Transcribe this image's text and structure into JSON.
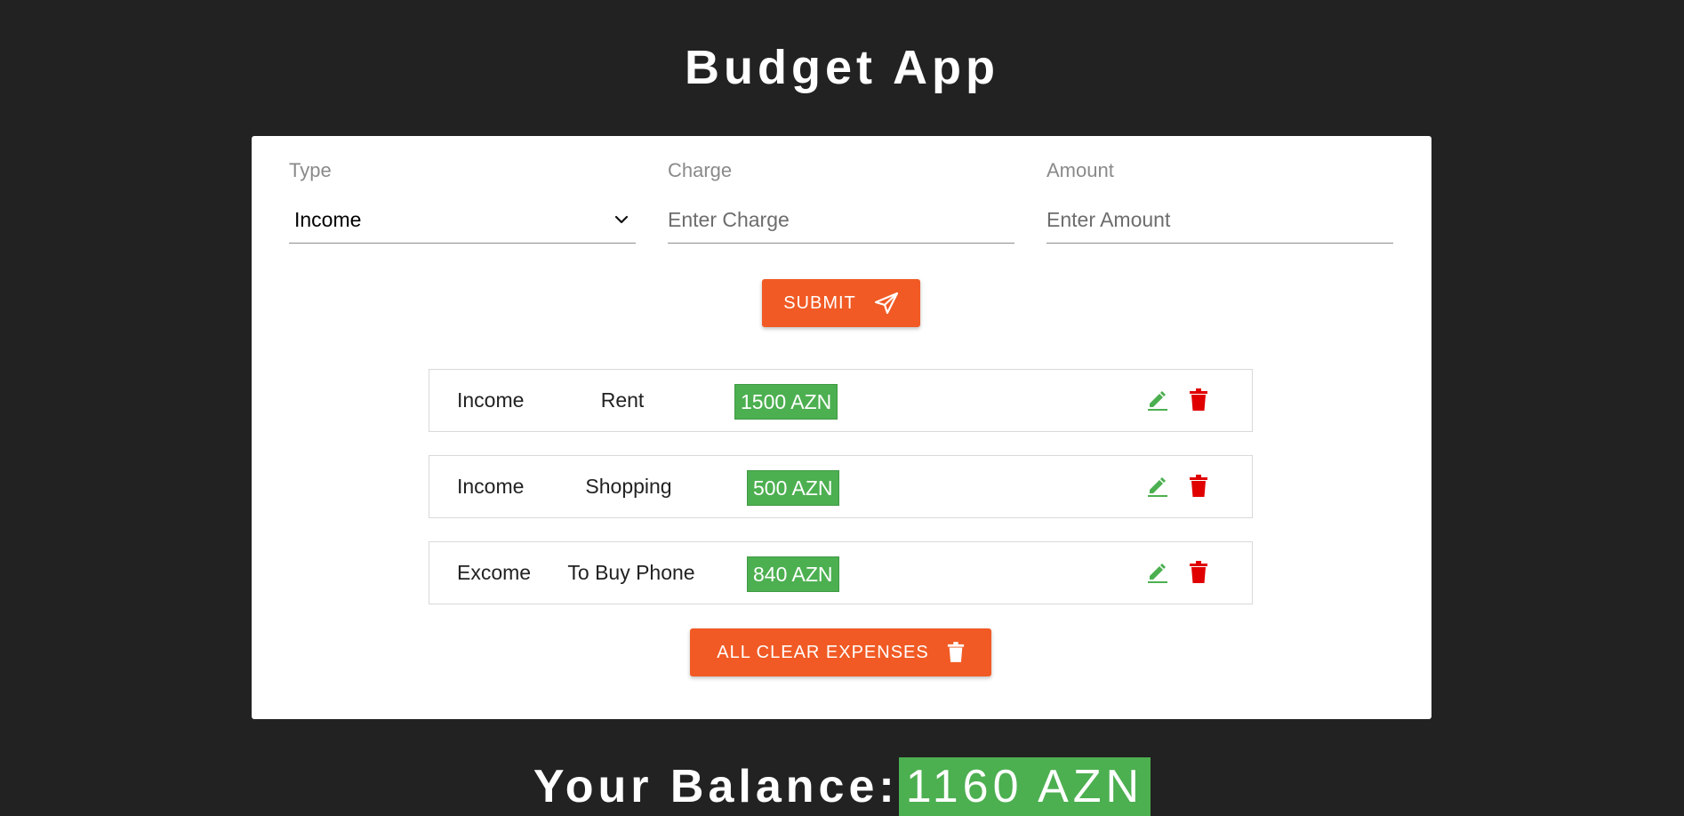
{
  "app": {
    "title": "Budget App"
  },
  "form": {
    "type_label": "Type",
    "type_value": "Income",
    "charge_label": "Charge",
    "charge_placeholder": "Enter Charge",
    "charge_value": "",
    "amount_label": "Amount",
    "amount_placeholder": "Enter Amount",
    "amount_value": "",
    "submit_label": "SUBMIT",
    "submit_icon": "paper-plane-icon"
  },
  "expenses": [
    {
      "type": "Income",
      "charge": "Rent",
      "amount": "1500 AZN",
      "edit_icon": "pencil-icon",
      "delete_icon": "trash-icon"
    },
    {
      "type": "Income",
      "charge": "Shopping",
      "amount": "500 AZN",
      "edit_icon": "pencil-icon",
      "delete_icon": "trash-icon"
    },
    {
      "type": "Excome",
      "charge": "To Buy Phone",
      "amount": "840 AZN",
      "edit_icon": "pencil-icon",
      "delete_icon": "trash-icon"
    }
  ],
  "actions": {
    "clear_label": "ALL CLEAR EXPENSES",
    "clear_icon": "trash-icon"
  },
  "balance": {
    "label": "Your Balance:",
    "value": "1160 AZN"
  },
  "colors": {
    "background": "#222222",
    "card": "#ffffff",
    "accent": "#f15a24",
    "amount_badge": "#4caf50",
    "edit_icon": "#4caf50",
    "delete_icon": "#e00000"
  }
}
